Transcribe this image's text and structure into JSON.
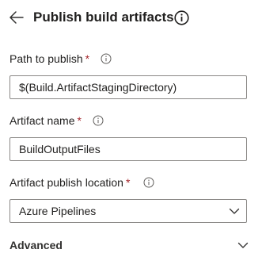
{
  "header": {
    "title": "Publish build artifacts",
    "back_icon": "arrow-left-icon",
    "info_icon": "info-icon"
  },
  "fields": {
    "path_to_publish": {
      "label": "Path to publish",
      "required_mark": "*",
      "value": "$(Build.ArtifactStagingDirectory)"
    },
    "artifact_name": {
      "label": "Artifact name",
      "required_mark": "*",
      "value": "BuildOutputFiles"
    },
    "artifact_publish_location": {
      "label": "Artifact publish location",
      "required_mark": "*",
      "selected": "Azure Pipelines"
    }
  },
  "sections": {
    "advanced": {
      "label": "Advanced"
    }
  },
  "colors": {
    "required": "#a4262c",
    "text": "#201f1e",
    "border": "#8a8886"
  }
}
